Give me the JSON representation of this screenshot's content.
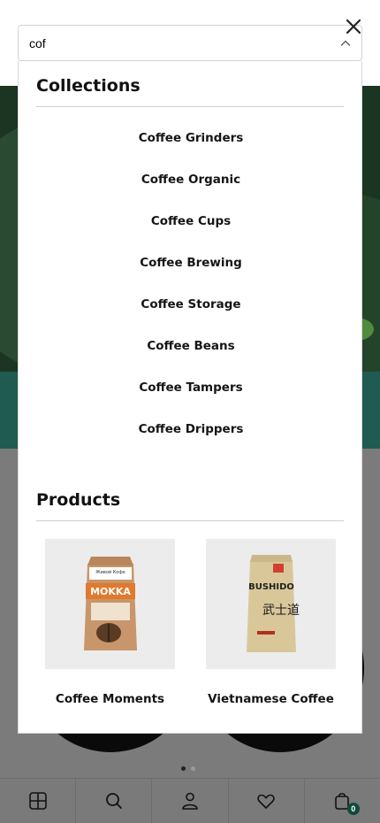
{
  "search": {
    "value": "cof",
    "placeholder": "Search"
  },
  "collections": {
    "title": "Collections",
    "items": [
      "Coffee Grinders",
      "Coffee Organic",
      "Coffee Cups",
      "Coffee Brewing",
      "Coffee Storage",
      "Coffee Beans",
      "Coffee Tampers",
      "Coffee Drippers"
    ]
  },
  "products": {
    "title": "Products",
    "items": [
      {
        "name": "Coffee Moments",
        "package_brand": "Живой Кофе",
        "package_label": "MOKKA",
        "package_color": "#c8966a"
      },
      {
        "name": "Vietnamese Coffee",
        "package_brand": "BUSHIDO",
        "package_label": "武士道",
        "package_color": "#d9c79a"
      }
    ]
  },
  "bottom_nav": {
    "items": [
      "grid-icon",
      "search-icon",
      "user-icon",
      "heart-icon",
      "cart-icon"
    ],
    "cart_count": "0"
  },
  "colors": {
    "overlay": "#7b7b7b",
    "accent": "#0f4a3a",
    "text": "#151515"
  }
}
